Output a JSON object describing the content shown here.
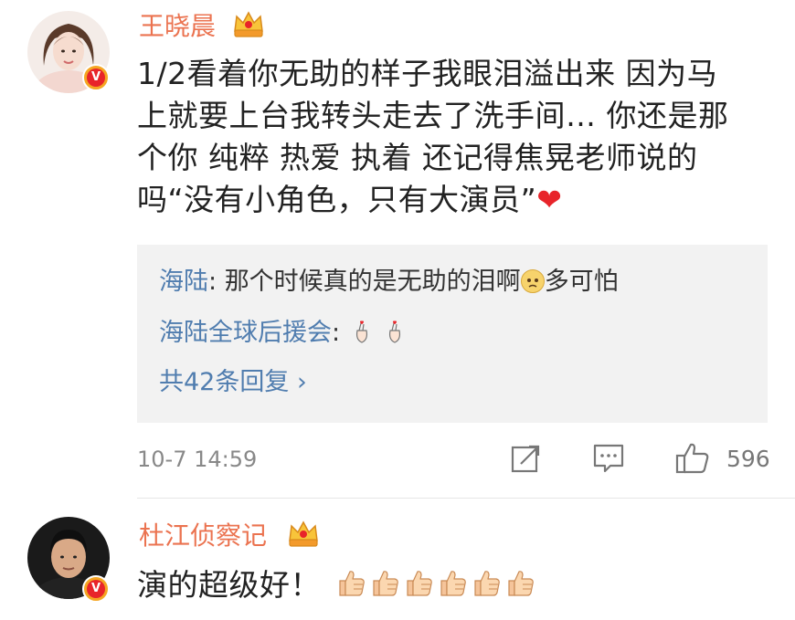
{
  "comments": [
    {
      "username": "王晓晨",
      "text_lines": [
        "1/2看着你无助的样子我眼泪溢出来 因为马",
        "上就要上台我转头走去了洗手间… 你还是那",
        "个你 纯粹 热爱 执着 还记得焦晃老师说的",
        "吗“没有小角色，只有大演员”"
      ],
      "heart": "❤",
      "replies": [
        {
          "name": "海陆",
          "sep": ": ",
          "text": "那个时候真的是无助的泪啊",
          "text_after": "多可怕"
        },
        {
          "name": "海陆全球后援会",
          "sep": ": ",
          "text": ""
        }
      ],
      "more_replies": "共42条回复 ›",
      "timestamp": "10-7 14:59",
      "like_count": "596"
    },
    {
      "username": "杜江侦察记",
      "text": "演的超级好！"
    }
  ],
  "icons": {
    "verified": "V",
    "crown": "crown-icon",
    "share": "share-icon",
    "comment": "comment-icon",
    "like": "like-icon",
    "thumbs_up_count": 6
  },
  "colors": {
    "username": "#eb7350",
    "link": "#507daf",
    "badge": "#e8242a",
    "reply_bg": "#f2f2f2"
  }
}
